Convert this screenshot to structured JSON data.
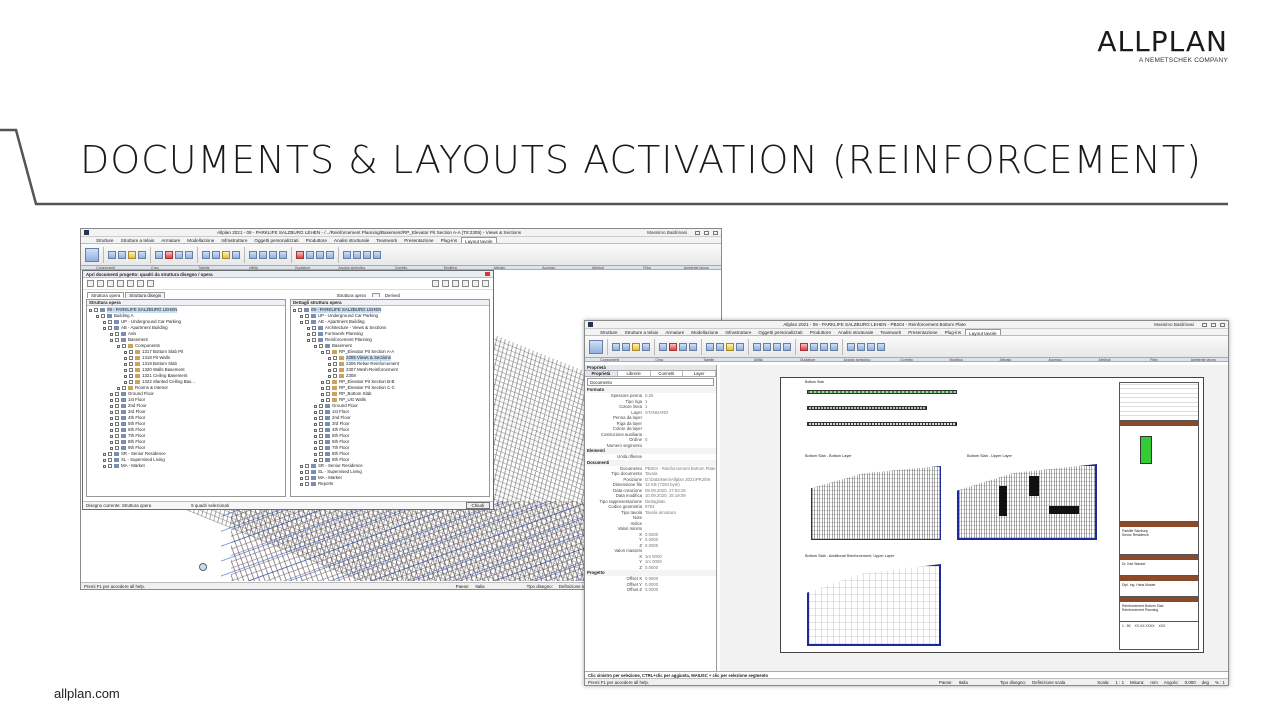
{
  "slide": {
    "logo": {
      "brand": "ALLPLAN",
      "tagline": "A NEMETSCHEK COMPANY"
    },
    "title": "DOCUMENTS & LAYOUTS ACTIVATION (REINFORCEMENT)",
    "footer_url": "allplan.com"
  },
  "window1": {
    "title": "Allplan 2021 - 09 - PARKLIFE SALZBURG LEHEN - /.../Reinforcement Planning/Basement/RP_Elevator Pit Section A-A (T8:2305) - Views & Sections",
    "user": "Massimo Baldrinasi",
    "tabs": [
      "Strutture",
      "Strutture a telaio",
      "Armature",
      "Modellazione",
      "Infrastrutture",
      "Oggetti personalizzati",
      "Produttore",
      "Analisi strutturale",
      "Teamwork",
      "Presentazione",
      "Plug-ins",
      "Layout tavole"
    ],
    "active_tab": "Layout tavole",
    "ribbon_groups": [
      "Componenti",
      "Crea",
      "Tabelle",
      "Utilità",
      "Quotature",
      "Acciaio simbolico",
      "Corretto",
      "Modifica",
      "Attivato",
      "Accesso",
      "Attributi",
      "Filtro",
      "Ambiente lavoro"
    ],
    "statusbar": {
      "help": "Premi F1 per accedere all help.",
      "country_label": "Paese:",
      "country": "Italia",
      "drawing_type_label": "Tipo disegno:",
      "drawing_type": "Definizione scala"
    }
  },
  "dialog": {
    "title": "Apri documenti progetto: quadri da struttura disegno / opera",
    "tabs": [
      "Struttura opera",
      "Struttura disegni"
    ],
    "left_header": "Struttura opera",
    "right_caption": "Struttura opera",
    "derived_label": "Derived",
    "right_header": "Dettagli struttura opera",
    "left_tree": [
      {
        "label": "09 - PARKLIFE SALZBURG LEHEN",
        "level": 0,
        "icon": "project",
        "selected": true
      },
      {
        "label": "Building A",
        "level": 1
      },
      {
        "label": "UP - Underground Car Parking",
        "level": 2
      },
      {
        "label": "AB - Apartment Building",
        "level": 2
      },
      {
        "label": "Axis",
        "level": 3
      },
      {
        "label": "Basement",
        "level": 3
      },
      {
        "label": "Components",
        "level": 4
      },
      {
        "label": "1317   Bottom Slab Pit",
        "level": 5
      },
      {
        "label": "1318   Pit Walls",
        "level": 5
      },
      {
        "label": "1319   Bottom Slab",
        "level": 5
      },
      {
        "label": "1320   Walls Basement",
        "level": 5
      },
      {
        "label": "1321   Ceiling Basement",
        "level": 5
      },
      {
        "label": "1322   Slanted Ceiling Bas...",
        "level": 5
      },
      {
        "label": "Rooms & Interior",
        "level": 4
      },
      {
        "label": "Ground Floor",
        "level": 3
      },
      {
        "label": "1st Floor",
        "level": 3
      },
      {
        "label": "2nd Floor",
        "level": 3
      },
      {
        "label": "3rd Floor",
        "level": 3
      },
      {
        "label": "4th Floor",
        "level": 3
      },
      {
        "label": "5th Floor",
        "level": 3
      },
      {
        "label": "6th Floor",
        "level": 3
      },
      {
        "label": "7th Floor",
        "level": 3
      },
      {
        "label": "8th Floor",
        "level": 3
      },
      {
        "label": "9th Floor",
        "level": 3
      },
      {
        "label": "SR - Senior Residence",
        "level": 2
      },
      {
        "label": "SL - Supervised Living",
        "level": 2
      },
      {
        "label": "MA - Market",
        "level": 2
      }
    ],
    "right_tree": [
      {
        "label": "09 - PARKLIFE SALZBURG LEHEN",
        "level": 0,
        "selected": true
      },
      {
        "label": "UP - Underground Car Parking",
        "level": 1
      },
      {
        "label": "AB - Apartment Building",
        "level": 1
      },
      {
        "label": "Architecture - Views & Sections",
        "level": 2
      },
      {
        "label": "Formwork Planning",
        "level": 2
      },
      {
        "label": "Reinforcement Planning",
        "level": 2
      },
      {
        "label": "Basement",
        "level": 3
      },
      {
        "label": "RP_Elevator Pit Section A-A",
        "level": 4
      },
      {
        "label": "2305   Views & Sections",
        "level": 5,
        "selected": true
      },
      {
        "label": "2306   Rebar-Reinforcement",
        "level": 5
      },
      {
        "label": "2307   Mesh-Reinforcement",
        "level": 5
      },
      {
        "label": "2308",
        "level": 5
      },
      {
        "label": "RP_Elevator Pit Section B-B",
        "level": 4
      },
      {
        "label": "RP_Elevator Pit Section C-C",
        "level": 4
      },
      {
        "label": "RP_Bottom Slab",
        "level": 4
      },
      {
        "label": "RP_UG Walls",
        "level": 4
      },
      {
        "label": "Ground Floor",
        "level": 3
      },
      {
        "label": "1st Floor",
        "level": 3
      },
      {
        "label": "2nd Floor",
        "level": 3
      },
      {
        "label": "3rd Floor",
        "level": 3
      },
      {
        "label": "4th Floor",
        "level": 3
      },
      {
        "label": "5th Floor",
        "level": 3
      },
      {
        "label": "6th Floor",
        "level": 3
      },
      {
        "label": "7th Floor",
        "level": 3
      },
      {
        "label": "8th Floor",
        "level": 3
      },
      {
        "label": "9th Floor",
        "level": 3
      },
      {
        "label": "SR - Senior Residence",
        "level": 1
      },
      {
        "label": "SL - Supervised Living",
        "level": 1
      },
      {
        "label": "MA - Market",
        "level": 1
      },
      {
        "label": "Reports",
        "level": 1
      }
    ],
    "status_left": "Disegno corrente: Struttura opera",
    "status_mid": "9 quadri selezionati",
    "ok_label": "Chiudi"
  },
  "window2": {
    "title": "Allplan 2021 - 09 - PARKLIFE SALZBURG LEHEN - PB204 - Reinforcement Bottom Plate",
    "user": "Massimo Baldrinasi",
    "tabs": [
      "Strutture",
      "Strutture a telaio",
      "Armature",
      "Modellazione",
      "Infrastrutture",
      "Oggetti personalizzati",
      "Produttore",
      "Analisi strutturale",
      "Teamwork",
      "Presentazione",
      "Plug-ins",
      "Layout tavole"
    ],
    "active_tab": "Layout tavole",
    "properties": {
      "header": "Proprietà",
      "tabs": [
        "Proprietà",
        "Librerie",
        "Connetti",
        "Layer"
      ],
      "filter": "Documento",
      "sections": [
        {
          "name": "Formato",
          "rows": [
            [
              "Spessore penna",
              "0.25"
            ],
            [
              "Tipo riga",
              "1"
            ],
            [
              "Colore linea",
              "1"
            ],
            [
              "Layer",
              "STANDARD"
            ],
            [
              "Penna da layer",
              ""
            ],
            [
              "Riga da layer",
              ""
            ],
            [
              "Colore da layer",
              ""
            ],
            [
              "Costruzione ausiliaria",
              ""
            ],
            [
              "Ordine",
              "0"
            ],
            [
              "Numero segmento",
              ""
            ]
          ]
        },
        {
          "name": "Elementi",
          "rows": [
            [
              "Unità riflesse",
              ""
            ]
          ]
        },
        {
          "name": "Documenti",
          "rows": [
            [
              "Documento",
              "PB204 - Reinforcement Bottom Plate"
            ],
            [
              "Tipo documento",
              "Tavola"
            ],
            [
              "Posizione",
              "D:\\Data\\Nem\\Allplan 2021\\PRJ\\09"
            ],
            [
              "Dimensione file",
              "12 KB (7294 byte)"
            ],
            [
              "Data creazione",
              "09.09.2020, 17:53:18"
            ],
            [
              "Data modifica",
              "10.09.2020, 15:19:09"
            ],
            [
              "Tipo rappresentazione",
              "Dettagliato"
            ],
            [
              "Codice geometria",
              "9754"
            ],
            [
              "Tipo tavola",
              "Tavola armatura"
            ],
            [
              "Note",
              ""
            ],
            [
              "Indice",
              ""
            ],
            [
              "Valori minimi",
              ""
            ],
            [
              "X",
              "0.0000"
            ],
            [
              "Y",
              "0.0000"
            ],
            [
              "Z",
              "0.0000"
            ],
            [
              "Valori massimi",
              ""
            ],
            [
              "X",
              "1m 0000"
            ],
            [
              "Y",
              "1m 0000"
            ],
            [
              "Z",
              "0.0000"
            ]
          ]
        },
        {
          "name": "Progetto",
          "rows": [
            [
              "Offset X",
              "0.0000"
            ],
            [
              "Offset Y",
              "0.0000"
            ],
            [
              "Offset Z",
              "0.0000"
            ]
          ]
        }
      ]
    },
    "layout": {
      "labels": [
        "Bottom Slab",
        "Bottom Slab - Bottom Layer",
        "Bottom Slab - Upper Layer",
        "Bottom Slab - Additional Reinforcement, Upper Layer"
      ],
      "titleblock": [
        "Parklife Salzburg",
        "Senior Residence",
        "Dr. Karl Wacker",
        "Dipl. Ing. Hans Muster",
        "Reinforcement Bottom Slab",
        "Reinforcement Planning",
        "1 : 50",
        "XX.XX.XXXX",
        "XXX"
      ]
    },
    "command_hint": "Clic sinistro per selezione, CTRL+clic per aggiunta, MAIUSC + clic per selezione segmento",
    "statusbar": {
      "help": "Premi F1 per accedere all help.",
      "country_label": "Paese:",
      "country": "Italia",
      "drawing_type_label": "Tipo disegno:",
      "drawing_type": "Definizione scala",
      "scale_label": "Scala:",
      "scale": "1 : 1",
      "length_label": "Misura:",
      "length": "mm",
      "angle_label": "Angolo:",
      "angle": "0.000",
      "unit": "deg",
      "pct": "% : 1"
    }
  }
}
